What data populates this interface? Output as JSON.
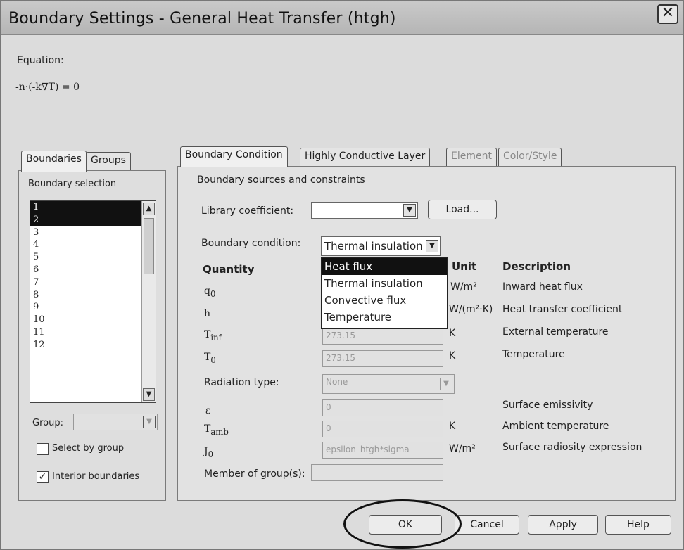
{
  "window": {
    "title": "Boundary Settings - General Heat Transfer (htgh)",
    "close_glyph": "✕"
  },
  "equation": {
    "label": "Equation:",
    "formula": "-n·(-k∇T) = 0"
  },
  "left_tabs": [
    "Boundaries",
    "Groups"
  ],
  "boundary_selection": {
    "label": "Boundary selection",
    "items": [
      "1",
      "2",
      "3",
      "4",
      "5",
      "6",
      "7",
      "8",
      "9",
      "10",
      "11",
      "12"
    ],
    "selected": [
      "1",
      "2"
    ]
  },
  "group": {
    "label": "Group:",
    "value": ""
  },
  "checkboxes": {
    "select_by_group": {
      "label": "Select by group",
      "checked": false
    },
    "interior_boundaries": {
      "label": "Interior boundaries",
      "checked": true,
      "mark": "✓"
    }
  },
  "right_tabs": [
    "Boundary Condition",
    "Highly Conductive Layer",
    "Element",
    "Color/Style"
  ],
  "section_label": "Boundary sources and constraints",
  "library_coefficient": {
    "label": "Library coefficient:",
    "value": "",
    "load_button": "Load..."
  },
  "boundary_condition": {
    "label": "Boundary condition:",
    "value": "Thermal insulation",
    "options": [
      "Heat flux",
      "Thermal insulation",
      "Convective flux",
      "Temperature"
    ],
    "highlighted": "Heat flux"
  },
  "table_headers": {
    "quantity": "Quantity",
    "unit": "Unit",
    "description": "Description"
  },
  "rows": [
    {
      "quantity_main": "q",
      "quantity_sub": "0",
      "value": "",
      "unit": "W/m²",
      "description": "Inward heat flux"
    },
    {
      "quantity_main": "h",
      "quantity_sub": "",
      "value": "",
      "unit": "W/(m²·K)",
      "description": "Heat transfer coefficient"
    },
    {
      "quantity_main": "T",
      "quantity_sub": "inf",
      "value": "273.15",
      "unit": "K",
      "description": "External temperature"
    },
    {
      "quantity_main": "T",
      "quantity_sub": "0",
      "value": "273.15",
      "unit": "K",
      "description": "Temperature"
    }
  ],
  "radiation": {
    "label": "Radiation type:",
    "value": "None"
  },
  "radiation_rows": [
    {
      "quantity_main": "ε",
      "quantity_sub": "",
      "value": "0",
      "unit": "",
      "description": "Surface emissivity"
    },
    {
      "quantity_main": "T",
      "quantity_sub": "amb",
      "value": "0",
      "unit": "K",
      "description": "Ambient temperature"
    },
    {
      "quantity_main": "J",
      "quantity_sub": "0",
      "value": "epsilon_htgh*sigma_",
      "unit": "W/m²",
      "description": "Surface radiosity expression"
    }
  ],
  "member_of_groups": {
    "label": "Member of group(s):",
    "value": ""
  },
  "buttons": {
    "ok": "OK",
    "cancel": "Cancel",
    "apply": "Apply",
    "help": "Help"
  },
  "icons": {
    "dropdown": "chevron-down-icon",
    "scroll_up": "arrow-up-icon",
    "scroll_down": "arrow-down-icon",
    "close": "close-icon"
  }
}
